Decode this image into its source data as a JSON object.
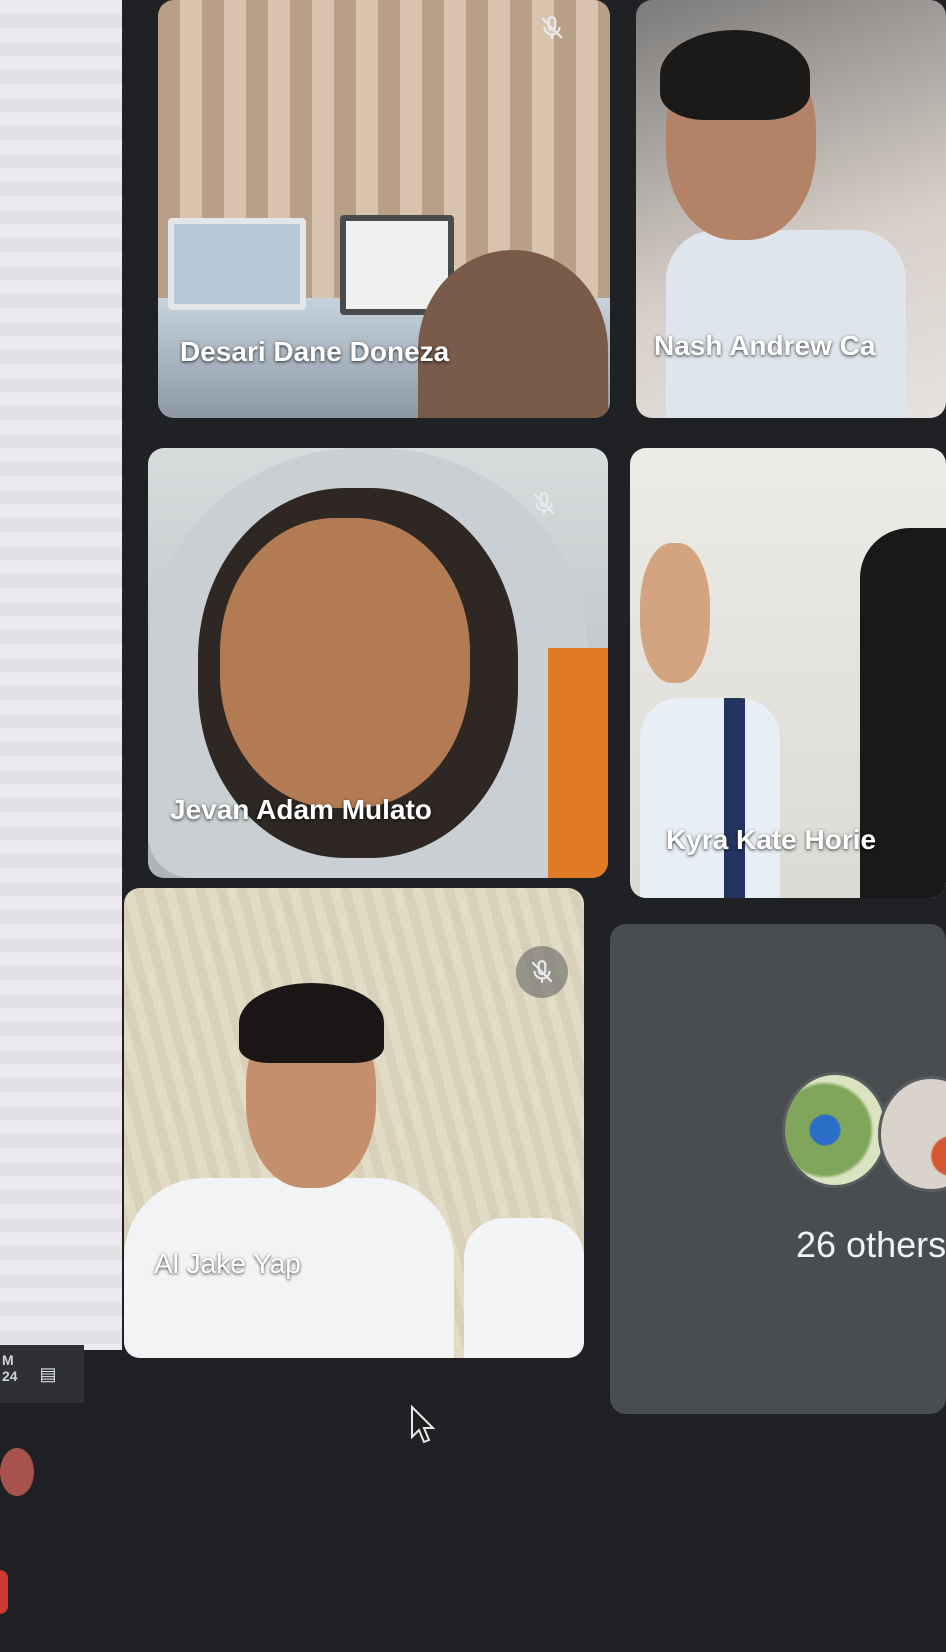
{
  "participants": [
    {
      "name": "Desari Dane Doneza",
      "muted": true
    },
    {
      "name": "Nash Andrew Ca",
      "muted": false
    },
    {
      "name": "Jevan Adam Mulato",
      "muted": true
    },
    {
      "name": "Kyra Kate Horie",
      "muted": false
    },
    {
      "name": "Al Jake Yap",
      "muted": true
    }
  ],
  "others_tile": {
    "label": "26 others"
  },
  "taskbar": {
    "time_fragment": "M\n24"
  },
  "icons": {
    "mute": "mic-off-icon",
    "notification": "notification-icon",
    "cursor": "mouse-pointer-icon"
  }
}
